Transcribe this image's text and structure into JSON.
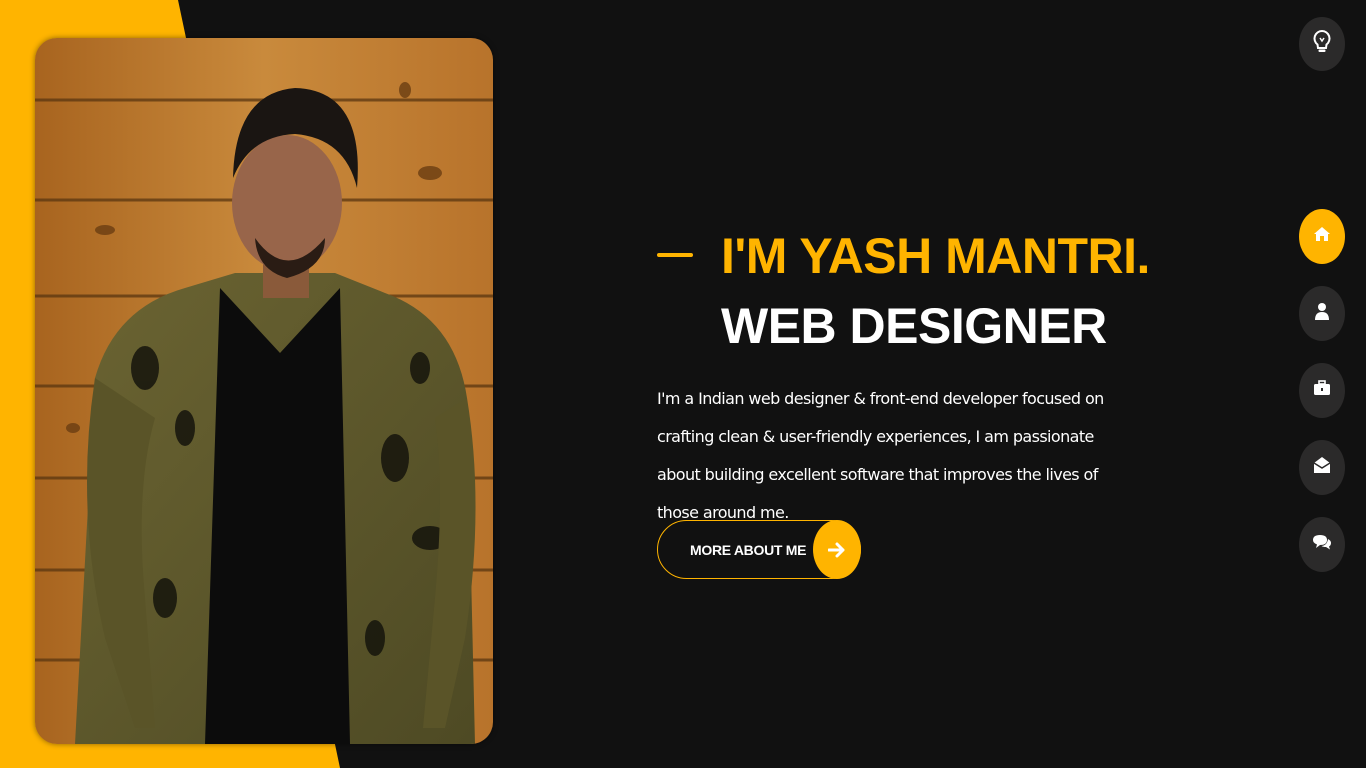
{
  "colors": {
    "accent": "#ffb400",
    "background": "#111111",
    "nav_button": "#2b2a2a",
    "text": "#ffffff"
  },
  "theme_toggle": {
    "icon": "lightbulb-icon"
  },
  "nav": {
    "items": [
      {
        "icon": "home-icon",
        "active": true
      },
      {
        "icon": "user-icon",
        "active": false
      },
      {
        "icon": "briefcase-icon",
        "active": false
      },
      {
        "icon": "envelope-open-icon",
        "active": false
      },
      {
        "icon": "chat-bubbles-icon",
        "active": false
      }
    ]
  },
  "hero": {
    "name_line": "I'M YASH MANTRI.",
    "role_line": "WEB DESIGNER",
    "intro": "I'm a Indian web designer & front-end developer focused on crafting clean & user-friendly experiences, I am passionate about building excellent software that improves the lives of those around me.",
    "button_label": "MORE ABOUT ME",
    "button_icon": "arrow-right-icon"
  },
  "portrait": {
    "subject": "portrait-photo"
  }
}
